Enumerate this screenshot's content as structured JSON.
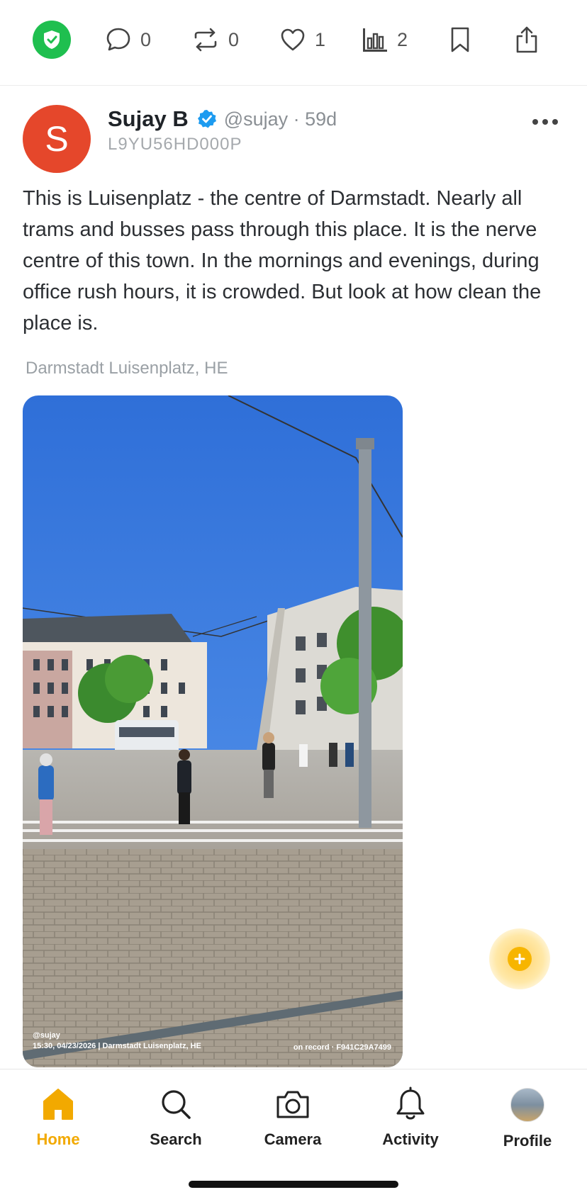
{
  "action_bar": {
    "items": [
      {
        "icon": "shield-check-icon"
      },
      {
        "icon": "comment-icon",
        "count": "0"
      },
      {
        "icon": "repost-icon",
        "count": "0"
      },
      {
        "icon": "heart-icon",
        "count": "1"
      },
      {
        "icon": "stats-icon",
        "count": "2"
      },
      {
        "icon": "bookmark-icon"
      },
      {
        "icon": "share-icon"
      }
    ]
  },
  "post": {
    "avatar_letter": "S",
    "author_name": "Sujay B",
    "handle": "@sujay · 59d",
    "post_id": "L9YU56HD000P",
    "text": "This is Luisenplatz - the centre of Darmstadt. Nearly all trams and busses pass through this place. It is the nerve centre of this town. In the mornings and evenings, during office rush hours, it is crowded. But look at how clean the place is.",
    "location": "Darmstadt Luisenplatz, HE",
    "photo": {
      "watermark_user": "@sujay",
      "watermark_line": "15:30, 04/23/2026 | Darmstadt Luisenplatz, HE",
      "watermark_record": "on record · F941C29A7499"
    }
  },
  "bottom_nav": {
    "items": [
      {
        "label": "Home",
        "icon": "home-icon",
        "active": true
      },
      {
        "label": "Search",
        "icon": "search-icon"
      },
      {
        "label": "Camera",
        "icon": "camera-icon"
      },
      {
        "label": "Activity",
        "icon": "bell-icon"
      },
      {
        "label": "Profile",
        "icon": "profile-avatar"
      }
    ]
  },
  "colors": {
    "accent": "#f2a900",
    "avatar_bg": "#e5472b",
    "shield_green": "#1fbf4f",
    "verified_blue": "#1d9bf0"
  }
}
